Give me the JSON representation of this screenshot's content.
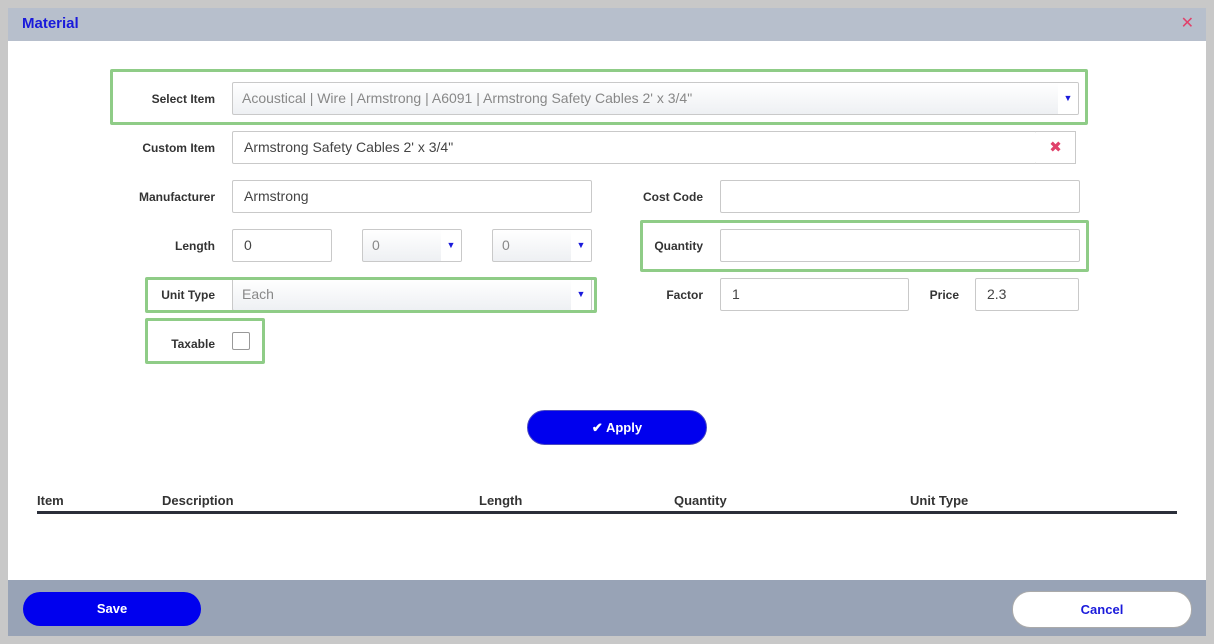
{
  "dialog": {
    "title": "Material"
  },
  "form": {
    "select_item": {
      "label": "Select Item",
      "value": "Acoustical | Wire | Armstrong | A6091 | Armstrong Safety Cables 2' x 3/4\""
    },
    "custom_item": {
      "label": "Custom Item",
      "value": "Armstrong Safety Cables 2' x 3/4\""
    },
    "manufacturer": {
      "label": "Manufacturer",
      "value": "Armstrong"
    },
    "cost_code": {
      "label": "Cost Code",
      "value": ""
    },
    "length": {
      "label": "Length",
      "value": "0",
      "select1": "0",
      "select2": "0"
    },
    "quantity": {
      "label": "Quantity",
      "value": ""
    },
    "unit_type": {
      "label": "Unit Type",
      "value": "Each"
    },
    "factor": {
      "label": "Factor",
      "value": "1"
    },
    "price": {
      "label": "Price",
      "value": "2.3"
    },
    "taxable": {
      "label": "Taxable",
      "checked": false
    }
  },
  "apply_label": "Apply",
  "table": {
    "columns": [
      "Item",
      "Description",
      "Length",
      "Quantity",
      "Unit Type"
    ]
  },
  "footer": {
    "save_label": "Save",
    "cancel_label": "Cancel"
  },
  "colors": {
    "accent": "#0000ee",
    "highlight": "#8fcc87",
    "header_bg": "#b7bfcc",
    "footer_bg": "#98a3b6",
    "close": "#e0426b"
  }
}
